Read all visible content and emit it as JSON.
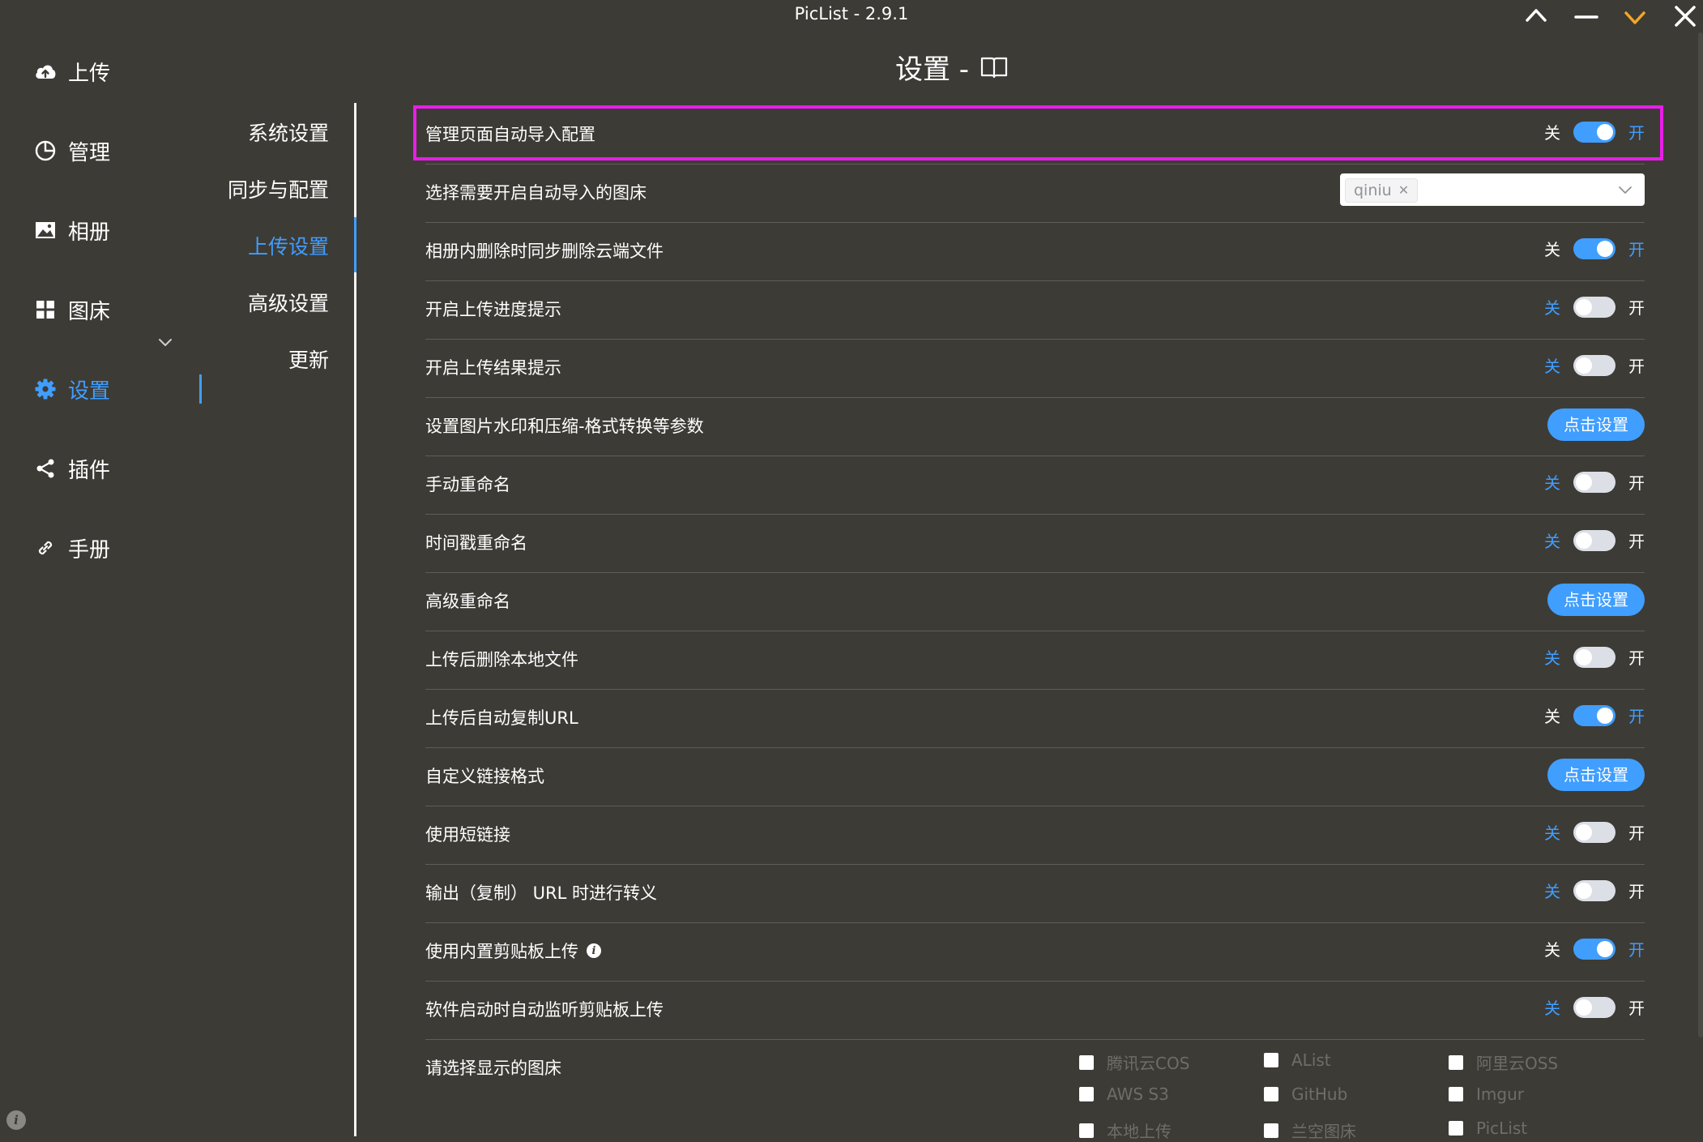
{
  "window": {
    "title": "PicList - 2.9.1",
    "accent": "#409eff",
    "highlight": "#e81ee8"
  },
  "nav": {
    "items": [
      {
        "label": "上传",
        "icon": "cloud-upload-icon"
      },
      {
        "label": "管理",
        "icon": "pie-chart-icon"
      },
      {
        "label": "相册",
        "icon": "picture-icon"
      },
      {
        "label": "图床",
        "icon": "grid-icon"
      },
      {
        "label": "设置",
        "icon": "gear-icon",
        "active": true
      },
      {
        "label": "插件",
        "icon": "share-icon"
      },
      {
        "label": "手册",
        "icon": "link-icon"
      }
    ]
  },
  "submenu": {
    "items": [
      "系统设置",
      "同步与配置",
      "上传设置",
      "高级设置",
      "更新"
    ],
    "active": "上传设置"
  },
  "header": {
    "title": "设置 -"
  },
  "toggle_text": {
    "off": "关",
    "on": "开"
  },
  "rows": [
    {
      "label": "管理页面自动导入配置",
      "type": "switch",
      "on": true
    },
    {
      "label": "选择需要开启自动导入的图床",
      "type": "select",
      "tag": "qiniu"
    },
    {
      "label": "相册内删除时同步删除云端文件",
      "type": "switch",
      "on": true
    },
    {
      "label": "开启上传进度提示",
      "type": "switch",
      "on": false
    },
    {
      "label": "开启上传结果提示",
      "type": "switch",
      "on": false
    },
    {
      "label": "设置图片水印和压缩-格式转换等参数",
      "type": "button",
      "button": "点击设置"
    },
    {
      "label": "手动重命名",
      "type": "switch",
      "on": false
    },
    {
      "label": "时间戳重命名",
      "type": "switch",
      "on": false
    },
    {
      "label": "高级重命名",
      "type": "button",
      "button": "点击设置"
    },
    {
      "label": "上传后删除本地文件",
      "type": "switch",
      "on": false
    },
    {
      "label": "上传后自动复制URL",
      "type": "switch",
      "on": true
    },
    {
      "label": "自定义链接格式",
      "type": "button",
      "button": "点击设置"
    },
    {
      "label": "使用短链接",
      "type": "switch",
      "on": false
    },
    {
      "label": "输出（复制） URL 时进行转义",
      "type": "switch",
      "on": false
    },
    {
      "label": "使用内置剪贴板上传",
      "type": "switch",
      "on": true,
      "info": true
    },
    {
      "label": "软件启动时自动监听剪贴板上传",
      "type": "switch",
      "on": false
    },
    {
      "label": "请选择显示的图床",
      "type": "checkboxes"
    }
  ],
  "picbeds": [
    [
      "腾讯云COS",
      "AList",
      "阿里云OSS"
    ],
    [
      "AWS S3",
      "GitHub",
      "Imgur"
    ],
    [
      "本地上传",
      "兰空图床",
      "PicList"
    ]
  ]
}
